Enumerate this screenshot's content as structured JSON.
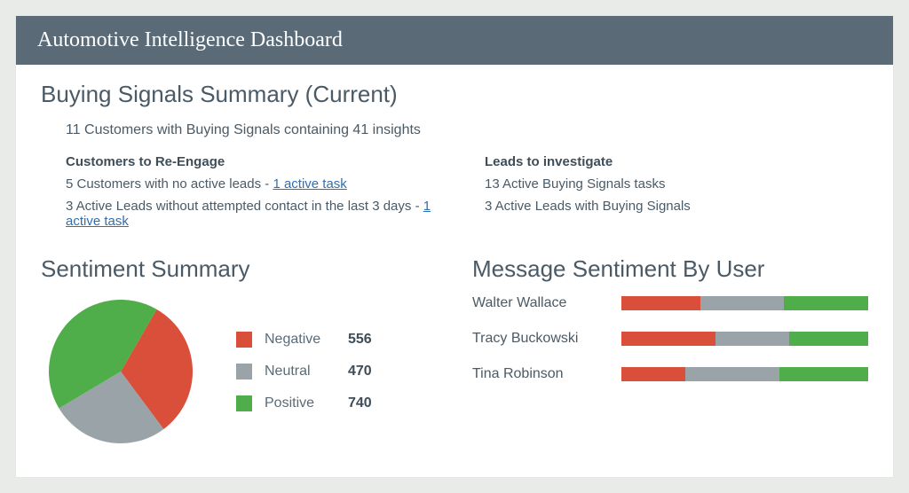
{
  "header": {
    "title": "Automotive Intelligence Dashboard"
  },
  "buying": {
    "title": "Buying Signals Summary (Current)",
    "summary": "11 Customers with Buying Signals containing 41 insights",
    "reengage": {
      "heading": "Customers to Re-Engage",
      "line1_prefix": "5 Customers with no active leads - ",
      "line1_link": "1 active task",
      "line2_prefix": "3 Active Leads without attempted contact in the last 3 days - ",
      "line2_link": "1 active task"
    },
    "investigate": {
      "heading": "Leads to investigate",
      "line1": "13 Active Buying Signals tasks",
      "line2": "3 Active Leads with Buying Signals"
    }
  },
  "sentiment": {
    "title": "Sentiment Summary",
    "legend": {
      "negative": {
        "label": "Negative",
        "value": "556"
      },
      "neutral": {
        "label": "Neutral",
        "value": "470"
      },
      "positive": {
        "label": "Positive",
        "value": "740"
      }
    }
  },
  "byUser": {
    "title": "Message Sentiment By User",
    "rows": [
      {
        "name": "Walter Wallace",
        "neg": 32,
        "neu": 34,
        "pos": 34
      },
      {
        "name": "Tracy Buckowski",
        "neg": 38,
        "neu": 30,
        "pos": 32
      },
      {
        "name": "Tina Robinson",
        "neg": 26,
        "neu": 38,
        "pos": 36
      }
    ]
  },
  "colors": {
    "negative": "#d94f3a",
    "neutral": "#9aa3a8",
    "positive": "#4fae4a"
  },
  "chart_data": [
    {
      "type": "pie",
      "title": "Sentiment Summary",
      "series": [
        {
          "name": "Negative",
          "value": 556,
          "color": "#d94f3a"
        },
        {
          "name": "Neutral",
          "value": 470,
          "color": "#9aa3a8"
        },
        {
          "name": "Positive",
          "value": 740,
          "color": "#4fae4a"
        }
      ]
    },
    {
      "type": "bar",
      "title": "Message Sentiment By User",
      "orientation": "horizontal-stacked",
      "categories": [
        "Walter Wallace",
        "Tracy Buckowski",
        "Tina Robinson"
      ],
      "series": [
        {
          "name": "Negative",
          "values": [
            32,
            38,
            26
          ],
          "color": "#d94f3a"
        },
        {
          "name": "Neutral",
          "values": [
            34,
            30,
            38
          ],
          "color": "#9aa3a8"
        },
        {
          "name": "Positive",
          "values": [
            34,
            32,
            36
          ],
          "color": "#4fae4a"
        }
      ],
      "xlabel": "",
      "ylabel": "",
      "unit": "percent (estimated)"
    }
  ]
}
